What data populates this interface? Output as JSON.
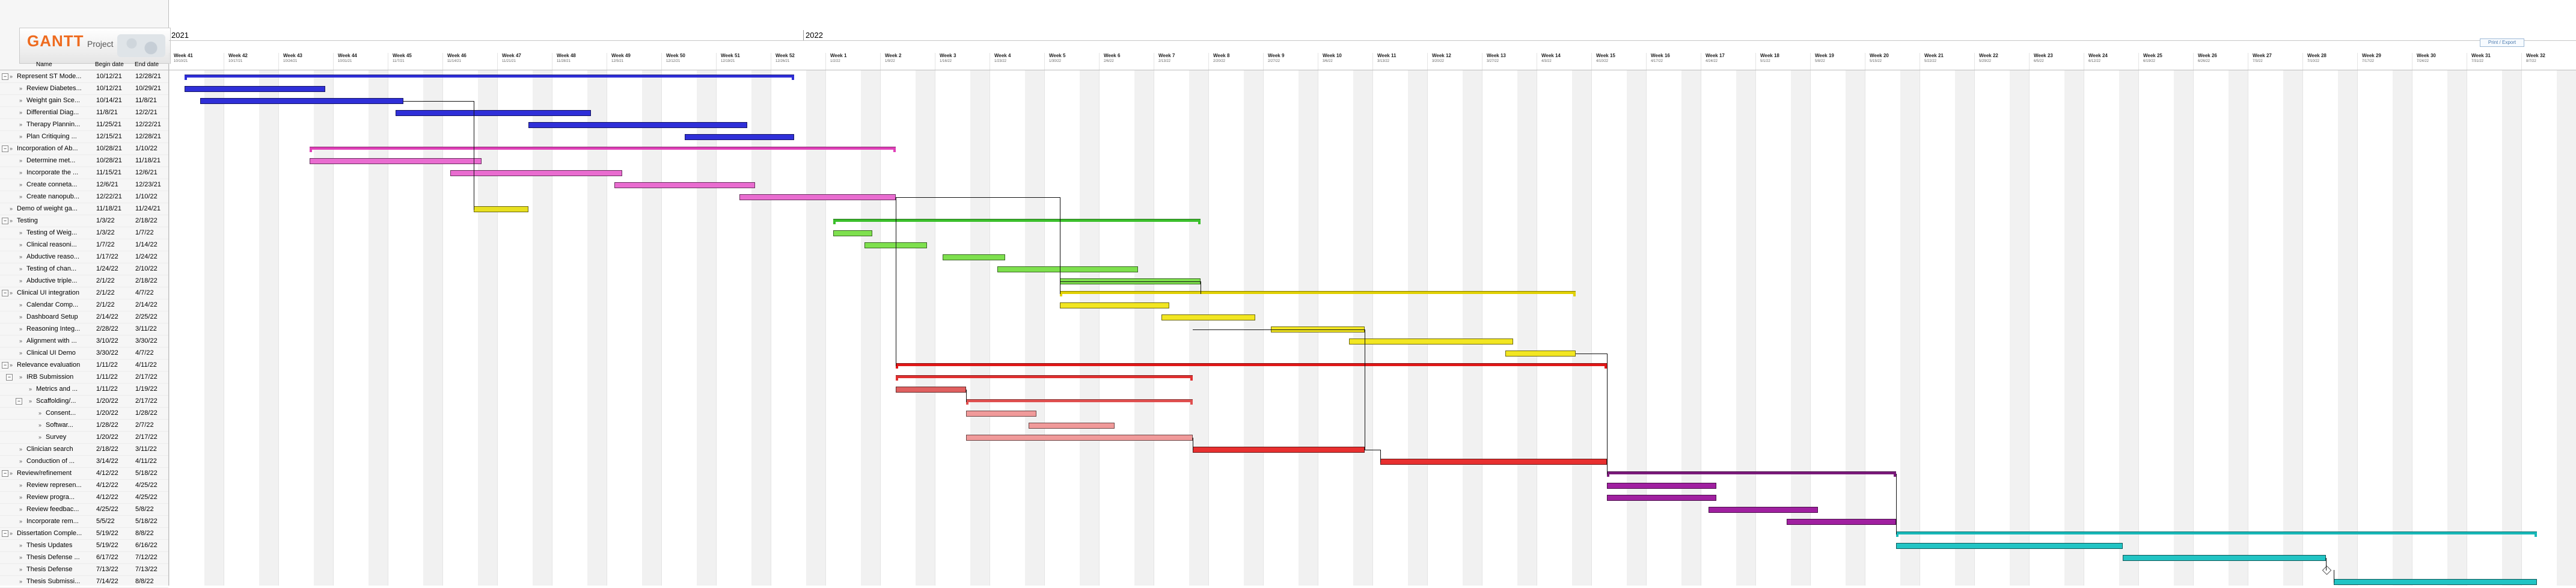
{
  "logo": {
    "text": "GANTT",
    "subtitle": "Project"
  },
  "columns": {
    "name": "Name",
    "begin": "Begin date",
    "end": "End date"
  },
  "timeline": {
    "years": [
      "2021",
      "2022"
    ],
    "weeks": [
      {
        "label": "Week 41",
        "date": "10/10/21"
      },
      {
        "label": "Week 42",
        "date": "10/17/21"
      },
      {
        "label": "Week 43",
        "date": "10/24/21"
      },
      {
        "label": "Week 44",
        "date": "10/31/21"
      },
      {
        "label": "Week 45",
        "date": "11/7/21"
      },
      {
        "label": "Week 46",
        "date": "11/14/21"
      },
      {
        "label": "Week 47",
        "date": "11/21/21"
      },
      {
        "label": "Week 48",
        "date": "11/28/21"
      },
      {
        "label": "Week 49",
        "date": "12/5/21"
      },
      {
        "label": "Week 50",
        "date": "12/12/21"
      },
      {
        "label": "Week 51",
        "date": "12/19/21"
      },
      {
        "label": "Week 52",
        "date": "12/26/21"
      },
      {
        "label": "Week 1",
        "date": "1/2/22"
      },
      {
        "label": "Week 2",
        "date": "1/9/22"
      },
      {
        "label": "Week 3",
        "date": "1/16/22"
      },
      {
        "label": "Week 4",
        "date": "1/23/22"
      },
      {
        "label": "Week 5",
        "date": "1/30/22"
      },
      {
        "label": "Week 6",
        "date": "2/6/22"
      },
      {
        "label": "Week 7",
        "date": "2/13/22"
      },
      {
        "label": "Week 8",
        "date": "2/20/22"
      },
      {
        "label": "Week 9",
        "date": "2/27/22"
      },
      {
        "label": "Week 10",
        "date": "3/6/22"
      },
      {
        "label": "Week 11",
        "date": "3/13/22"
      },
      {
        "label": "Week 12",
        "date": "3/20/22"
      },
      {
        "label": "Week 13",
        "date": "3/27/22"
      },
      {
        "label": "Week 14",
        "date": "4/3/22"
      },
      {
        "label": "Week 15",
        "date": "4/10/22"
      },
      {
        "label": "Week 16",
        "date": "4/17/22"
      },
      {
        "label": "Week 17",
        "date": "4/24/22"
      },
      {
        "label": "Week 18",
        "date": "5/1/22"
      },
      {
        "label": "Week 19",
        "date": "5/8/22"
      },
      {
        "label": "Week 20",
        "date": "5/15/22"
      },
      {
        "label": "Week 21",
        "date": "5/22/22"
      },
      {
        "label": "Week 22",
        "date": "5/29/22"
      },
      {
        "label": "Week 23",
        "date": "6/5/22"
      },
      {
        "label": "Week 24",
        "date": "6/12/22"
      },
      {
        "label": "Week 25",
        "date": "6/19/22"
      },
      {
        "label": "Week 26",
        "date": "6/26/22"
      },
      {
        "label": "Week 27",
        "date": "7/3/22"
      },
      {
        "label": "Week 28",
        "date": "7/10/22"
      },
      {
        "label": "Week 29",
        "date": "7/17/22"
      },
      {
        "label": "Week 30",
        "date": "7/24/22"
      },
      {
        "label": "Week 31",
        "date": "7/31/22"
      },
      {
        "label": "Week 32",
        "date": "8/7/22"
      }
    ],
    "print_button": "Print / Export"
  },
  "tasks": [
    {
      "name": "Represent ST Mode...",
      "begin": "10/12/21",
      "end": "12/28/21",
      "summary": true,
      "color": "#2f2fd8"
    },
    {
      "name": "Review Diabetes...",
      "begin": "10/12/21",
      "end": "10/29/21",
      "color": "#2f2fd8"
    },
    {
      "name": "Weight gain Sce...",
      "begin": "10/14/21",
      "end": "11/8/21",
      "color": "#2f2fd8"
    },
    {
      "name": "Differential Diag...",
      "begin": "11/8/21",
      "end": "12/2/21",
      "color": "#2f2fd8"
    },
    {
      "name": "Therapy Plannin...",
      "begin": "11/25/21",
      "end": "12/22/21",
      "color": "#2f2fd8"
    },
    {
      "name": "Plan Critiquing ...",
      "begin": "12/15/21",
      "end": "12/28/21",
      "color": "#2f2fd8"
    },
    {
      "name": "Incorporation of Ab...",
      "begin": "10/28/21",
      "end": "1/10/22",
      "summary": true,
      "color": "#e040b8"
    },
    {
      "name": "Determine met...",
      "begin": "10/28/21",
      "end": "11/18/21",
      "color": "#e96cd0"
    },
    {
      "name": "Incorporate the ...",
      "begin": "11/15/21",
      "end": "12/6/21",
      "color": "#e96cd0"
    },
    {
      "name": "Create conneta...",
      "begin": "12/6/21",
      "end": "12/23/21",
      "color": "#e96cd0"
    },
    {
      "name": "Create nanopub...",
      "begin": "12/22/21",
      "end": "1/10/22",
      "color": "#e96cd0"
    },
    {
      "name": "Demo of weight ga...",
      "begin": "11/18/21",
      "end": "11/24/21",
      "color": "#e8e020"
    },
    {
      "name": "Testing",
      "begin": "1/3/22",
      "end": "2/18/22",
      "summary": true,
      "color": "#3cbf2c"
    },
    {
      "name": "Testing of Weig...",
      "begin": "1/3/22",
      "end": "1/7/22",
      "color": "#7ee04e"
    },
    {
      "name": "Clinical reasoni...",
      "begin": "1/7/22",
      "end": "1/14/22",
      "color": "#7ee04e"
    },
    {
      "name": "Abductive reaso...",
      "begin": "1/17/22",
      "end": "1/24/22",
      "color": "#7ee04e"
    },
    {
      "name": "Testing of chan...",
      "begin": "1/24/22",
      "end": "2/10/22",
      "color": "#7ee04e"
    },
    {
      "name": "Abductive triple...",
      "begin": "2/1/22",
      "end": "2/18/22",
      "color": "#7ee04e"
    },
    {
      "name": "Clinical UI integration",
      "begin": "2/1/22",
      "end": "4/7/22",
      "summary": true,
      "color": "#e0d000"
    },
    {
      "name": "Calendar Comp...",
      "begin": "2/1/22",
      "end": "2/14/22",
      "color": "#f2e622"
    },
    {
      "name": "Dashboard Setup",
      "begin": "2/14/22",
      "end": "2/25/22",
      "color": "#f2e622"
    },
    {
      "name": "Reasoning Integ...",
      "begin": "2/28/22",
      "end": "3/11/22",
      "color": "#f2e622"
    },
    {
      "name": "Alignment with ...",
      "begin": "3/10/22",
      "end": "3/30/22",
      "color": "#f2e622"
    },
    {
      "name": "Clinical UI Demo",
      "begin": "3/30/22",
      "end": "4/7/22",
      "color": "#f2e622"
    },
    {
      "name": "Relevance evaluation",
      "begin": "1/11/22",
      "end": "4/11/22",
      "summary": true,
      "color": "#e01818"
    },
    {
      "name": "IRB Submission",
      "begin": "1/11/22",
      "end": "2/17/22",
      "summary": true,
      "color": "#e03030"
    },
    {
      "name": "Metrics and ...",
      "begin": "1/11/22",
      "end": "1/19/22",
      "color": "#e06060"
    },
    {
      "name": "Scaffolding/...",
      "begin": "1/20/22",
      "end": "2/17/22",
      "summary": true,
      "color": "#e05050"
    },
    {
      "name": "Consent...",
      "begin": "1/20/22",
      "end": "1/28/22",
      "color": "#f09a9a"
    },
    {
      "name": "Softwar...",
      "begin": "1/28/22",
      "end": "2/7/22",
      "color": "#f09a9a"
    },
    {
      "name": "Survey",
      "begin": "1/20/22",
      "end": "2/17/22",
      "color": "#f09a9a"
    },
    {
      "name": "Clinician search",
      "begin": "2/18/22",
      "end": "3/11/22",
      "color": "#e83030"
    },
    {
      "name": "Conduction of ...",
      "begin": "3/14/22",
      "end": "4/11/22",
      "color": "#e83030"
    },
    {
      "name": "Review/refinement",
      "begin": "4/12/22",
      "end": "5/18/22",
      "summary": true,
      "color": "#7a1a7a"
    },
    {
      "name": "Review represen...",
      "begin": "4/12/22",
      "end": "4/25/22",
      "color": "#a020a0"
    },
    {
      "name": "Review progra...",
      "begin": "4/12/22",
      "end": "4/25/22",
      "color": "#a020a0"
    },
    {
      "name": "Review feedbac...",
      "begin": "4/25/22",
      "end": "5/8/22",
      "color": "#a020a0"
    },
    {
      "name": "Incorporate rem...",
      "begin": "5/5/22",
      "end": "5/18/22",
      "color": "#a020a0"
    },
    {
      "name": "Dissertation Comple...",
      "begin": "5/19/22",
      "end": "8/8/22",
      "summary": true,
      "color": "#18b8b8"
    },
    {
      "name": "Thesis Updates",
      "begin": "5/19/22",
      "end": "6/16/22",
      "color": "#22c4c4"
    },
    {
      "name": "Thesis Defense ...",
      "begin": "6/17/22",
      "end": "7/12/22",
      "color": "#22c4c4"
    },
    {
      "name": "Thesis Defense",
      "begin": "7/13/22",
      "end": "7/13/22",
      "milestone": true,
      "color": "#22c4c4"
    },
    {
      "name": "Thesis Submissi...",
      "begin": "7/14/22",
      "end": "8/8/22",
      "color": "#22c4c4"
    }
  ]
}
